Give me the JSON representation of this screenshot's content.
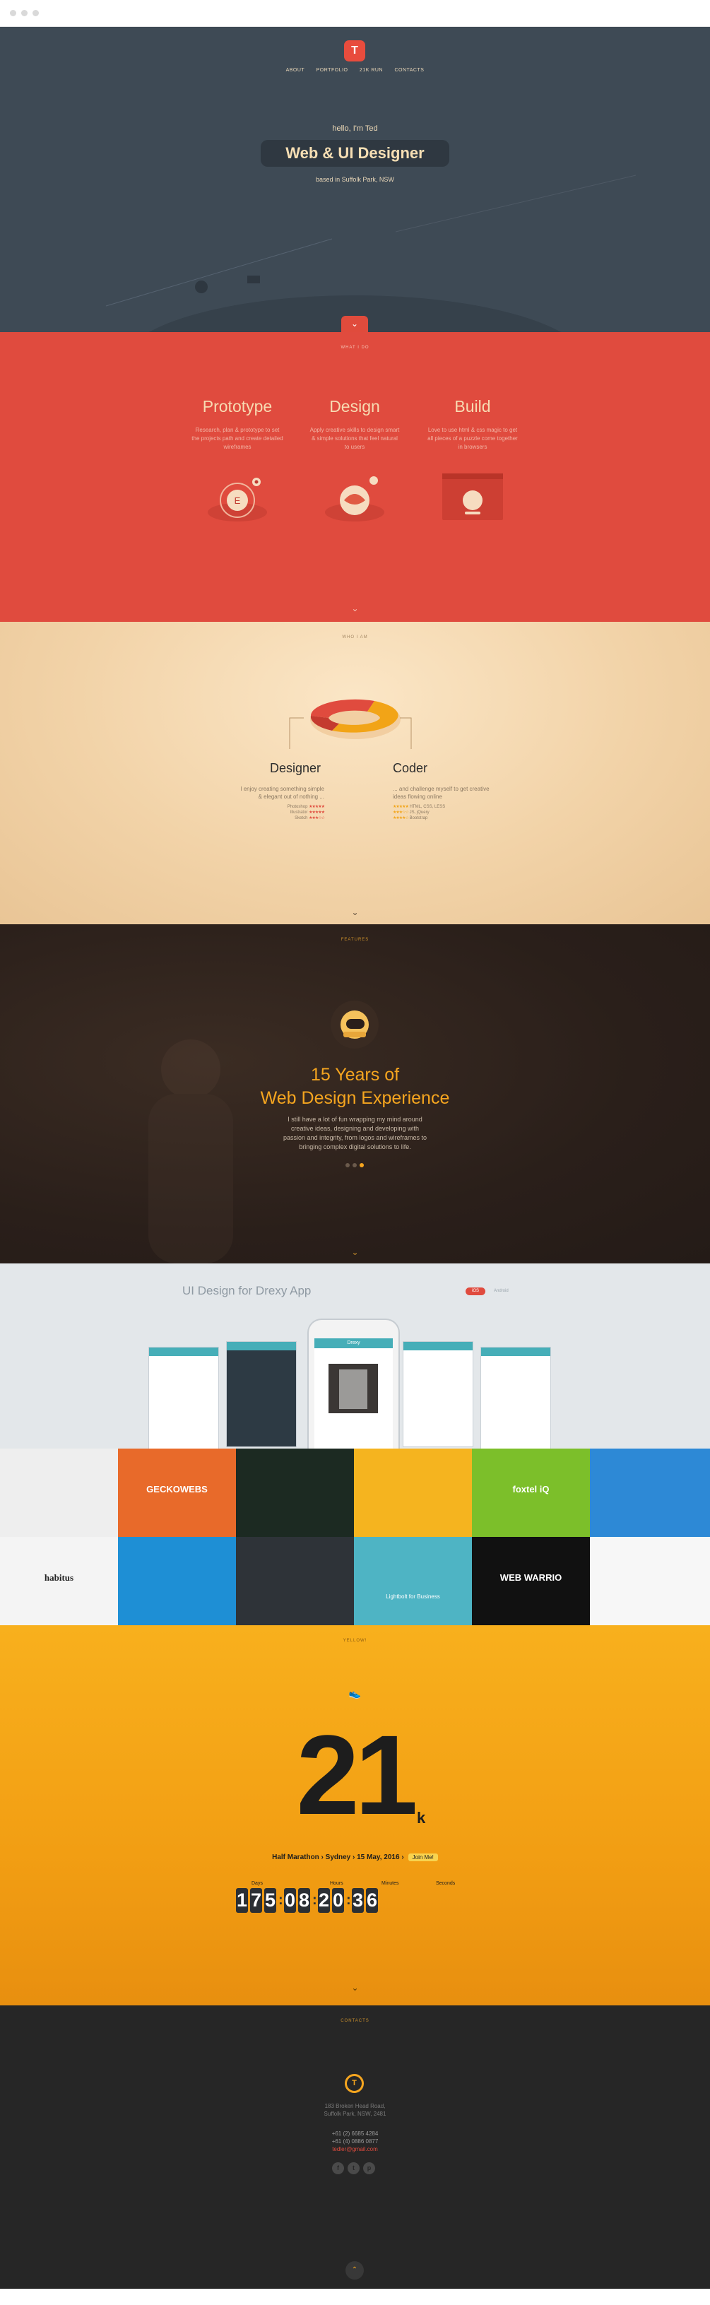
{
  "hero": {
    "logo": "T",
    "nav": [
      "ABOUT",
      "PORTFOLIO",
      "21K RUN",
      "CONTACTS"
    ],
    "hello": "hello, I'm Ted",
    "title": "Web & UI Designer",
    "based": "based in Suffolk Park, NSW"
  },
  "what": {
    "label": "WHAT I DO",
    "columns": [
      {
        "title": "Prototype",
        "text": "Research, plan & prototype to set the projects path and create detailed wireframes"
      },
      {
        "title": "Design",
        "text": "Apply creative skills to design smart & simple solutions that feel natural to users"
      },
      {
        "title": "Build",
        "text": "Love to use html & css magic to get all pieces of a puzzle come together in browsers"
      }
    ],
    "prototype_badge": "E"
  },
  "who": {
    "label": "WHO I AM",
    "designer": {
      "title": "Designer",
      "text": "I enjoy creating something simple & elegant out of nothing ...",
      "skills": [
        {
          "name": "Photoshop",
          "stars": "★★★★★"
        },
        {
          "name": "Illustrator",
          "stars": "★★★★★"
        },
        {
          "name": "Sketch",
          "stars": "★★★☆☆"
        }
      ]
    },
    "coder": {
      "title": "Coder",
      "text": "... and challenge myself to get creative ideas flowing online",
      "skills": [
        {
          "name": "HTML, CSS, LESS",
          "stars": "★★★★★"
        },
        {
          "name": "JS, jQuery",
          "stars": "★★★☆☆"
        },
        {
          "name": "Bootstrap",
          "stars": "★★★★☆"
        }
      ]
    },
    "colors": {
      "designer": "#e04b3e",
      "coder": "#f2a417"
    }
  },
  "features": {
    "label": "FEATURES",
    "title_line1": "15 Years of",
    "title_line2": "Web Design Experience",
    "text": "I still have a lot of fun wrapping my mind around creative ideas, designing and developing with passion and integrity, from logos and wireframes to bringing complex digital solutions to life."
  },
  "portfolio": {
    "title": "UI Design for Drexy App",
    "tab_ios": "iOS",
    "tab_android": "Android",
    "phone_app_name": "Drexy",
    "tiles": [
      {
        "label": "",
        "bg": "#eeeeee"
      },
      {
        "label": "GECKOWEBS",
        "bg": "#e86a2a"
      },
      {
        "label": "",
        "bg": "#1c2a22"
      },
      {
        "label": "",
        "bg": "#f5b41f"
      },
      {
        "label": "foxtel iQ",
        "bg": "#7cbf2a"
      },
      {
        "label": "",
        "bg": "#2d89d6"
      },
      {
        "label": "habitus",
        "bg": "#f4f4f4"
      },
      {
        "label": "",
        "bg": "#1e8fd5"
      },
      {
        "label": "",
        "bg": "#2e3338"
      },
      {
        "label": "Lightbolt for Business",
        "bg": "#4eb4c4"
      },
      {
        "label": "WEB WARRIO",
        "bg": "#111111"
      },
      {
        "label": "",
        "bg": "#f7f7f7"
      }
    ]
  },
  "yellow": {
    "label": "YELLOW!",
    "number": "21",
    "unit": "k",
    "race": "Half Marathon  ›  Sydney  ›  15 May, 2016  ›",
    "join": "Join Me!",
    "labels": [
      "Days",
      "Hours",
      "Minutes",
      "Seconds"
    ],
    "days": [
      "1",
      "7",
      "5"
    ],
    "hours": [
      "0",
      "8"
    ],
    "minutes": [
      "2",
      "0"
    ],
    "seconds": [
      "3",
      "6"
    ]
  },
  "contacts": {
    "label": "CONTACTS",
    "pin": "T",
    "address_line1": "183 Broken Head Road,",
    "address_line2": "Suffolk Park, NSW, 2481",
    "phone1": "+61 (2) 6685 4284",
    "phone2": "+61 (4) 0886 0877",
    "email": "tedler@gmail.com",
    "social_icons": [
      "facebook-icon",
      "twitter-icon",
      "pinterest-icon"
    ]
  }
}
